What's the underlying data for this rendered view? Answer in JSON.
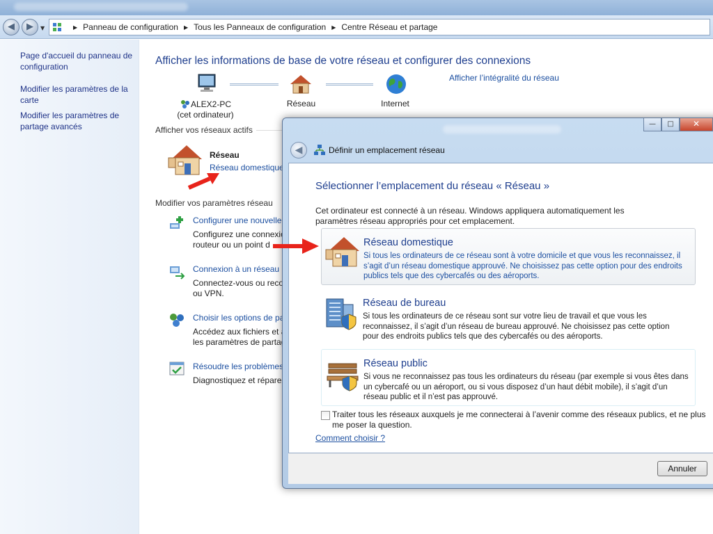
{
  "explorer": {
    "breadcrumb": [
      "Panneau de configuration",
      "Tous les Panneaux de configuration",
      "Centre Réseau et partage"
    ]
  },
  "sidebar": {
    "items": [
      {
        "label": "Page d'accueil du panneau de configuration"
      },
      {
        "label": "Modifier les paramètres de la carte"
      },
      {
        "label": "Modifier les paramètres de partage avancés"
      }
    ]
  },
  "main": {
    "heading": "Afficher les informations de base de votre réseau et configurer des connexions",
    "full_map_link": "Afficher l’intégralité du réseau",
    "map": {
      "computer_name": "ALEX2-PC",
      "computer_caption": "(cet ordinateur)",
      "network_label": "Réseau",
      "internet_label": "Internet"
    },
    "active_networks_label": "Afficher vos réseaux actifs",
    "active_network": {
      "name": "Réseau",
      "type_link": "Réseau domestique"
    },
    "change_settings_label": "Modifier vos paramètres réseau",
    "tasks": [
      {
        "title": "Configurer une nouvelle",
        "desc1": "Configurez une connexio",
        "desc2": "routeur ou un point d"
      },
      {
        "title": "Connexion à un réseau",
        "desc1": "Connectez-vous ou reco",
        "desc2": "ou VPN."
      },
      {
        "title": "Choisir les options de pa",
        "desc1": "Accédez aux fichiers et a",
        "desc2": "les paramètres de partag"
      },
      {
        "title": "Résoudre les problèmes",
        "desc1": "Diagnostiquez et réparez",
        "desc2": ""
      }
    ]
  },
  "dialog": {
    "title": "Définir un emplacement réseau",
    "heading": "Sélectionner l’emplacement du réseau « Réseau »",
    "intro_line1": "Cet ordinateur est connecté à un réseau. Windows appliquera automatiquement les",
    "intro_line2": "paramètres réseau appropriés pour cet emplacement.",
    "options": [
      {
        "title": "Réseau domestique",
        "lines": [
          "Si tous les ordinateurs de ce réseau sont à votre domicile et que vous les reconnaissez, il",
          "s’agit d’un réseau domestique approuvé. Ne choisissez pas cette option pour des endroits",
          "publics tels que des cybercafés ou des aéroports."
        ]
      },
      {
        "title": "Réseau de bureau",
        "lines": [
          "Si tous les ordinateurs de ce réseau sont sur votre lieu de travail et que vous les",
          "reconnaissez, il s’agit d’un réseau de bureau approuvé. Ne choisissez pas cette option",
          "pour des endroits publics tels que des cybercafés ou des aéroports."
        ]
      },
      {
        "title": "Réseau public",
        "lines": [
          "Si vous ne reconnaissez pas tous les ordinateurs du réseau (par exemple si vous êtes dans",
          "un cybercafé ou un aéroport, ou si vous disposez d’un haut débit mobile), il s’agit d’un",
          "réseau public et il n’est pas approuvé."
        ]
      }
    ],
    "checkbox_line1": "Traiter tous les réseaux auxquels je me connecterai à l’avenir comme des réseaux publics, et ne plus",
    "checkbox_line2": "me poser la question.",
    "help_link": "Comment choisir ?",
    "cancel_label": "Annuler"
  },
  "colors": {
    "link": "#1c4fa0",
    "heading": "#1e3e8e",
    "arrow": "#e8231a"
  }
}
